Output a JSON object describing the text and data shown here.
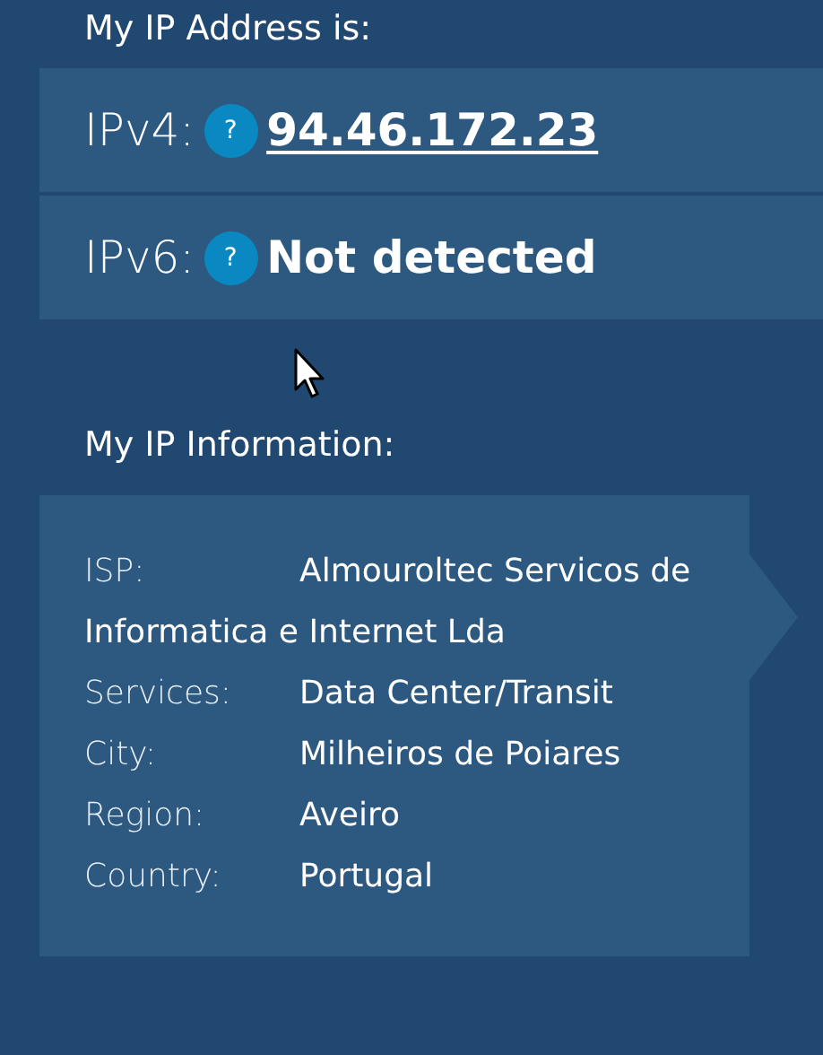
{
  "address_heading": "My IP Address is:",
  "addresses": [
    {
      "label": "IPv4:",
      "help": "?",
      "kind": "link",
      "value": "94.46.172.23"
    },
    {
      "label": "IPv6:",
      "help": "?",
      "kind": "text",
      "value": "Not detected"
    }
  ],
  "info_heading": "My IP Information:",
  "info": [
    {
      "label": "ISP:",
      "value": "Almouroltec Servicos de Informatica e Internet Lda"
    },
    {
      "label": "Services:",
      "value": "Data Center/Transit"
    },
    {
      "label": "City:",
      "value": "Milheiros de Poiares"
    },
    {
      "label": "Region:",
      "value": "Aveiro"
    },
    {
      "label": "Country:",
      "value": "Portugal"
    }
  ]
}
